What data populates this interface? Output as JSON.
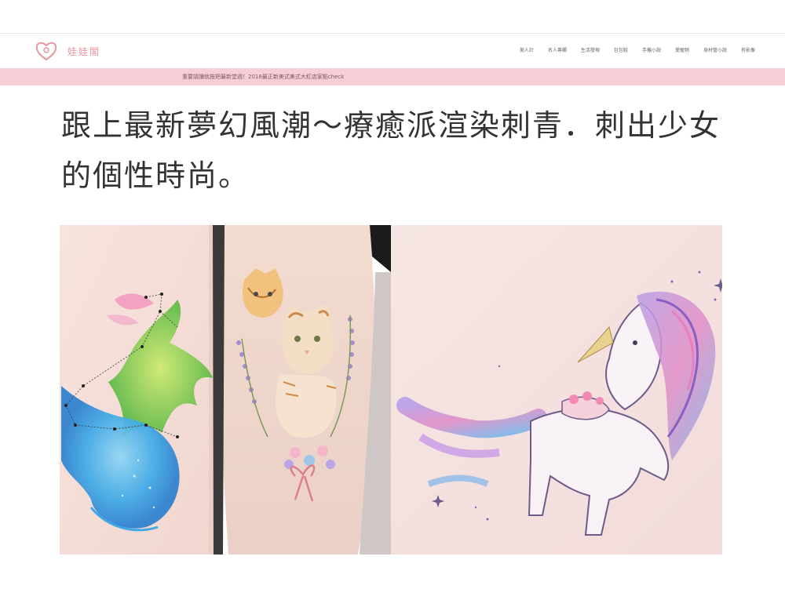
{
  "site": {
    "logo_text": "娃娃閣",
    "brand_color": "#e7989f",
    "announce_bg": "#f6cfd6"
  },
  "nav": {
    "items": [
      "美人計",
      "名人專欄",
      "生活發現",
      "包包鞋",
      "手機小說",
      "愛寵物",
      "身材管小說",
      "有影像"
    ]
  },
  "announcement": {
    "text": "重要請讀就按把最新堂週！2018最正新美式美式大紅店家點check"
  },
  "article": {
    "title": "跟上最新夢幻風潮～療癒派渲染刺青．刺出少女的個性時尚。"
  },
  "hero": {
    "panels": [
      "constellation-wolf-tattoo",
      "cats-lavender-tattoo",
      "unicorn-tattoo"
    ]
  }
}
